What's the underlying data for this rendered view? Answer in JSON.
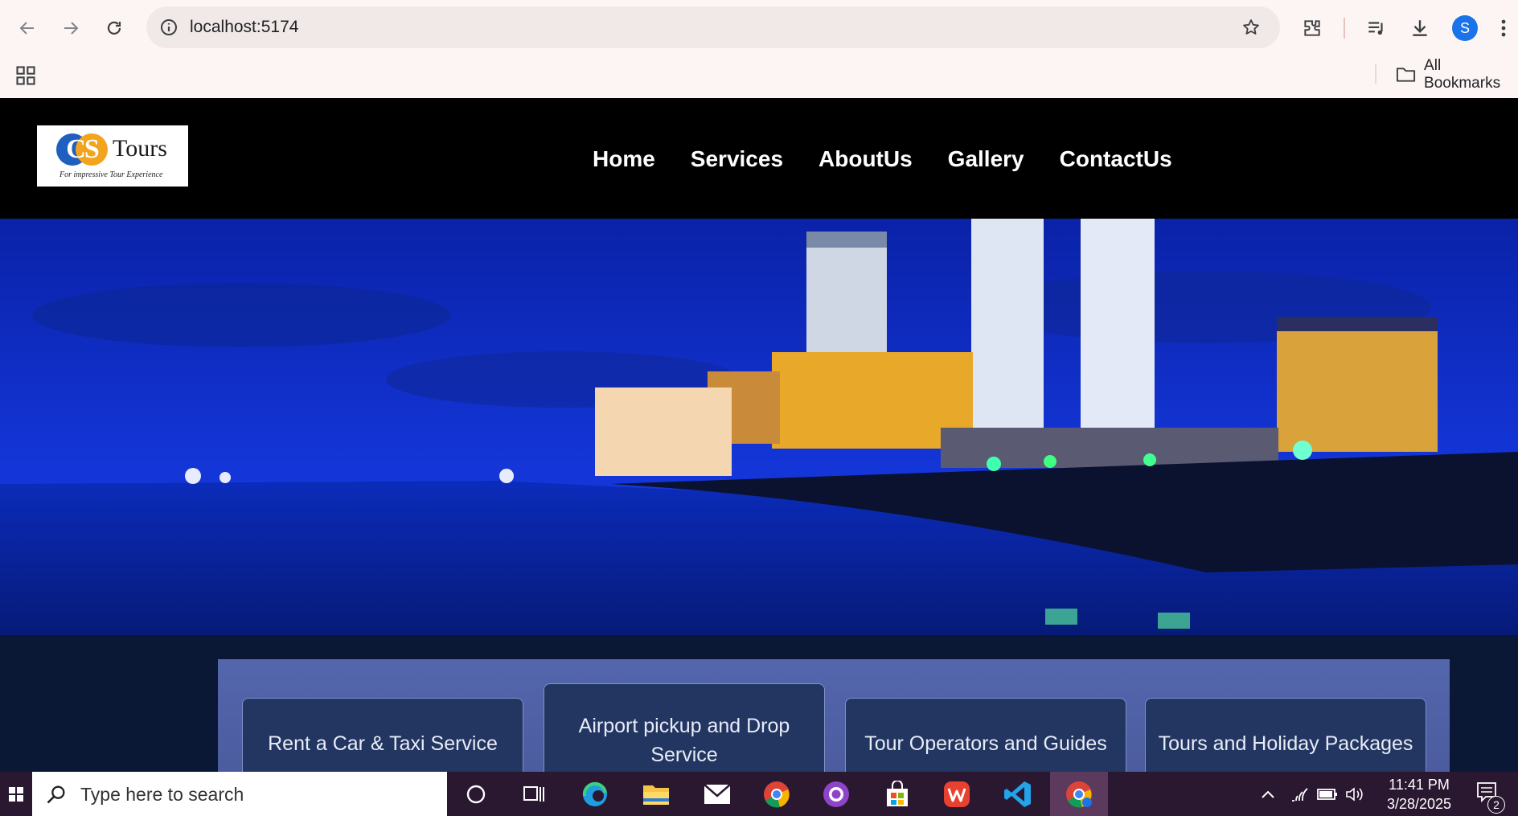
{
  "browser": {
    "url": "localhost:5174",
    "bookmarks_label": "All Bookmarks",
    "profile_initial": "S"
  },
  "site": {
    "logo": {
      "letters": "CS",
      "brand": "Tours",
      "tagline": "For impressive Tour Experience"
    },
    "nav": [
      "Home",
      "Services",
      "AboutUs",
      "Gallery",
      "ContactUs"
    ],
    "services": [
      "Rent a Car & Taxi Service",
      "Airport pickup and Drop Service",
      "Tour Operators and Guides",
      "Tours and Holiday Packages"
    ]
  },
  "taskbar": {
    "search_placeholder": "Type here to search",
    "time": "11:41 PM",
    "date": "3/28/2025",
    "notification_count": "2"
  },
  "colors": {
    "header_bg": "#000000",
    "services_panel": "#5466ad",
    "service_card": "#223661",
    "taskbar_bg": "#2a1730"
  }
}
